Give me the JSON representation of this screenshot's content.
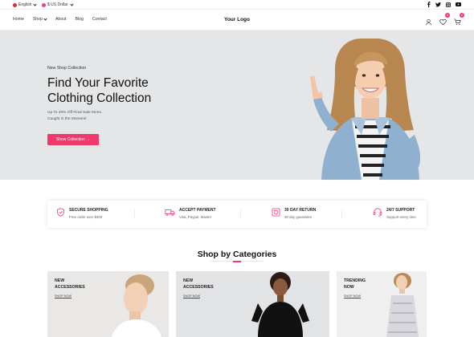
{
  "topbar": {
    "language": "English",
    "currency": "$ US Dollar",
    "social_icons": [
      "facebook-icon",
      "twitter-icon",
      "instagram-icon",
      "youtube-icon"
    ]
  },
  "nav": {
    "items": [
      {
        "label": "Home"
      },
      {
        "label": "Shop"
      },
      {
        "label": "About"
      },
      {
        "label": "Blog"
      },
      {
        "label": "Contact"
      }
    ],
    "logo": "Your Logo",
    "wishlist_count": "0",
    "cart_count": "0"
  },
  "hero": {
    "kicker": "New Shop Collection",
    "title_line1": "Find Your Favorite",
    "title_line2": "Clothing Collection",
    "desc_line1": "Up To 40% Off Final Sale Items.",
    "desc_line2": "Caught in the Moment!",
    "button": "Show Collection →"
  },
  "features": [
    {
      "title": "SECURE SHOPPING",
      "subtitle": "Free order over $300",
      "icon": "shield-check-icon"
    },
    {
      "title": "ACCEPT PAYMENT",
      "subtitle": "Visa, Paypal, Master",
      "icon": "truck-icon"
    },
    {
      "title": "30 DAY RETURN",
      "subtitle": "30 day guarantee",
      "icon": "return-box-icon"
    },
    {
      "title": "24/7 SUPPORT",
      "subtitle": "Support every time",
      "icon": "headset-icon"
    }
  ],
  "categories": {
    "title": "Shop by Categories",
    "cards": [
      {
        "line1": "NEW",
        "line2": "ACCESSORIES",
        "link": "SHOP NOW"
      },
      {
        "line1": "NEW",
        "line2": "ACCESSORIES",
        "link": "SHOP NOW"
      },
      {
        "line1": "TRENDING",
        "line2": "NOW",
        "link": "SHOP NOW"
      }
    ]
  },
  "colors": {
    "accent": "#f0386b",
    "hero_bg": "#e4e6e8"
  }
}
